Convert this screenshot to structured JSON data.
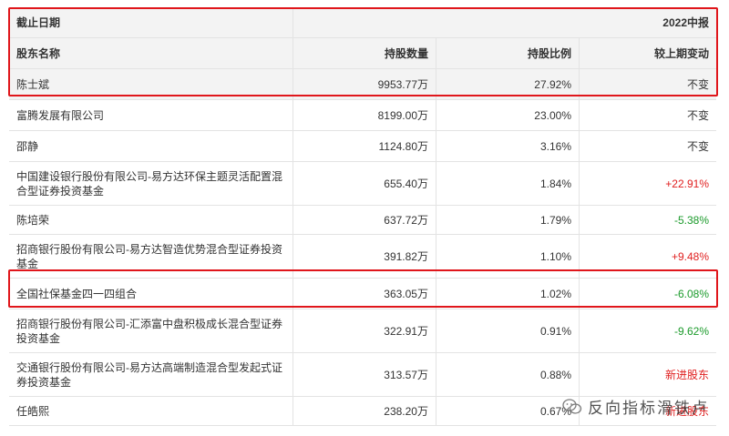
{
  "header": {
    "date_label": "截止日期",
    "period": "2022中报"
  },
  "columns": [
    "股东名称",
    "持股数量",
    "持股比例",
    "较上期变动"
  ],
  "rows": [
    {
      "name": "陈士斌",
      "shares": "9953.77万",
      "ratio": "27.92%",
      "change": "不变",
      "kind": "flat"
    },
    {
      "name": "富腾发展有限公司",
      "shares": "8199.00万",
      "ratio": "23.00%",
      "change": "不变",
      "kind": "flat"
    },
    {
      "name": "邵静",
      "shares": "1124.80万",
      "ratio": "3.16%",
      "change": "不变",
      "kind": "flat"
    },
    {
      "name": "中国建设银行股份有限公司-易方达环保主题灵活配置混合型证券投资基金",
      "shares": "655.40万",
      "ratio": "1.84%",
      "change": "+22.91%",
      "kind": "up"
    },
    {
      "name": "陈培荣",
      "shares": "637.72万",
      "ratio": "1.79%",
      "change": "-5.38%",
      "kind": "down"
    },
    {
      "name": "招商银行股份有限公司-易方达智造优势混合型证券投资基金",
      "shares": "391.82万",
      "ratio": "1.10%",
      "change": "+9.48%",
      "kind": "up"
    },
    {
      "name": "全国社保基金四一四组合",
      "shares": "363.05万",
      "ratio": "1.02%",
      "change": "-6.08%",
      "kind": "down"
    },
    {
      "name": "招商银行股份有限公司-汇添富中盘积极成长混合型证券投资基金",
      "shares": "322.91万",
      "ratio": "0.91%",
      "change": "-9.62%",
      "kind": "down"
    },
    {
      "name": "交通银行股份有限公司-易方达高端制造混合型发起式证券投资基金",
      "shares": "313.57万",
      "ratio": "0.88%",
      "change": "新进股东",
      "kind": "new"
    },
    {
      "name": "任皓熙",
      "shares": "238.20万",
      "ratio": "0.67%",
      "change": "新进股东",
      "kind": "new"
    }
  ],
  "watermark": "反向指标滑铁卢",
  "colors": {
    "highlight_border": "#e0161b",
    "up": "#e02020",
    "down": "#1a9a2a",
    "header_bg": "#f3f3f3"
  }
}
